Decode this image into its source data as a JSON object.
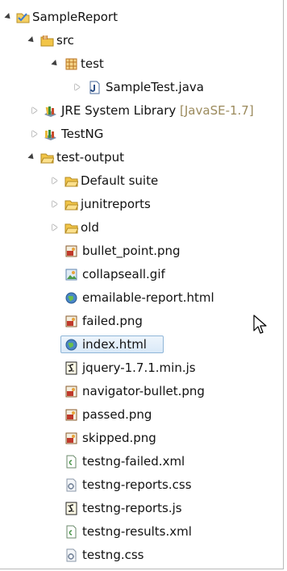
{
  "tree": {
    "items": [
      {
        "label": "SampleReport",
        "icon": "project-icon",
        "state": "open"
      },
      {
        "label": "src",
        "icon": "source-folder-icon",
        "state": "open"
      },
      {
        "label": "test",
        "icon": "package-icon",
        "state": "open"
      },
      {
        "label": "SampleTest.java",
        "icon": "java-file-icon",
        "state": "closed"
      },
      {
        "label": "JRE System Library",
        "decoration": "[JavaSE-1.7]",
        "icon": "library-icon",
        "state": "closed"
      },
      {
        "label": "TestNG",
        "icon": "library-icon",
        "state": "closed"
      },
      {
        "label": "test-output",
        "icon": "folder-icon",
        "state": "open"
      },
      {
        "label": "Default suite",
        "icon": "folder-icon",
        "state": "closed"
      },
      {
        "label": "junitreports",
        "icon": "folder-icon",
        "state": "closed"
      },
      {
        "label": "old",
        "icon": "folder-icon",
        "state": "closed"
      },
      {
        "label": "bullet_point.png",
        "icon": "png-image-icon"
      },
      {
        "label": "collapseall.gif",
        "icon": "gif-image-icon"
      },
      {
        "label": "emailable-report.html",
        "icon": "html-globe-icon"
      },
      {
        "label": "failed.png",
        "icon": "png-image-icon"
      },
      {
        "label": "index.html",
        "icon": "html-globe-icon",
        "selected": true
      },
      {
        "label": "jquery-1.7.1.min.js",
        "icon": "js-script-icon"
      },
      {
        "label": "navigator-bullet.png",
        "icon": "png-image-icon"
      },
      {
        "label": "passed.png",
        "icon": "png-image-icon"
      },
      {
        "label": "skipped.png",
        "icon": "png-image-icon"
      },
      {
        "label": "testng-failed.xml",
        "icon": "xml-file-icon"
      },
      {
        "label": "testng-reports.css",
        "icon": "css-file-icon"
      },
      {
        "label": "testng-reports.js",
        "icon": "js-script-icon"
      },
      {
        "label": "testng-results.xml",
        "icon": "xml-file-icon"
      },
      {
        "label": "testng.css",
        "icon": "css-file-icon"
      }
    ]
  },
  "colors": {
    "selection_border": "#8fb6d8",
    "selection_fill": "#d9e9f8",
    "decoration_text": "#9b8a5c",
    "folder_yellow": "#f2c548"
  }
}
